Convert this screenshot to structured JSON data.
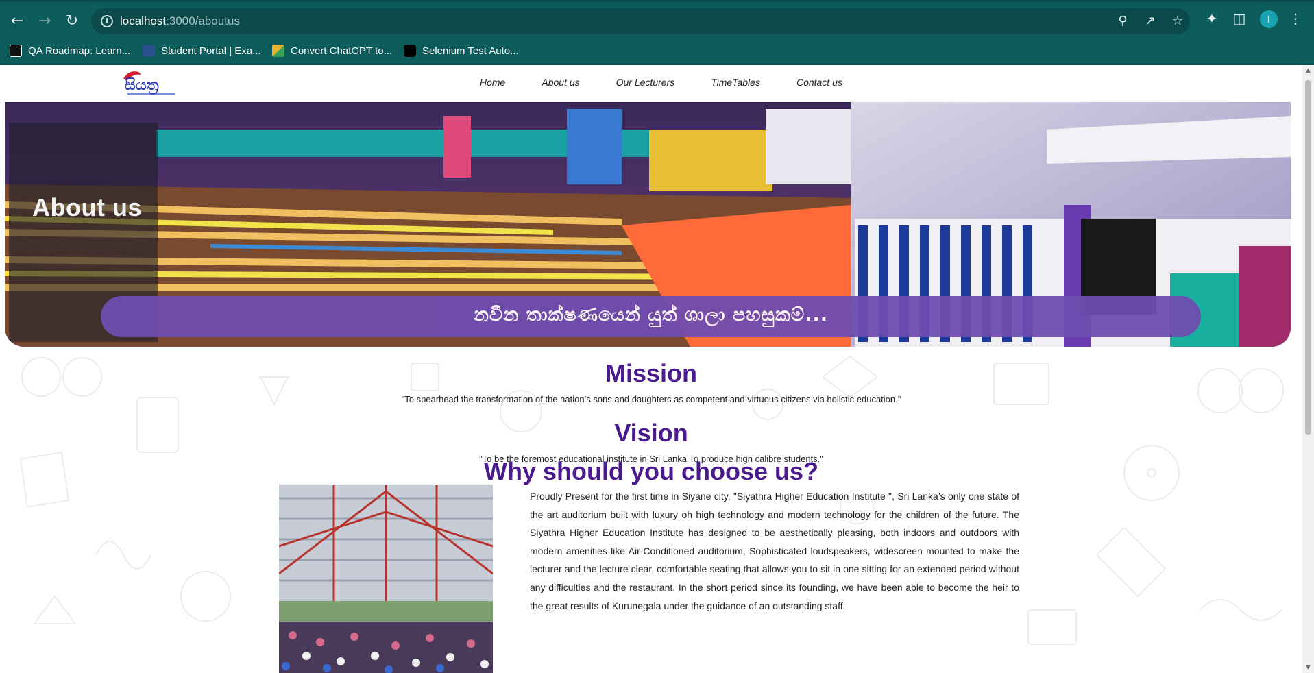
{
  "browser": {
    "url_host": "localhost",
    "url_path": ":3000/aboutus",
    "profile_initial": "I",
    "bookmarks": [
      {
        "label": "QA Roadmap: Learn..."
      },
      {
        "label": "Student Portal | Exa..."
      },
      {
        "label": "Convert ChatGPT to..."
      },
      {
        "label": "Selenium Test Auto..."
      }
    ],
    "colors": {
      "chrome": "#0d5c5c",
      "omnibox": "#0a4a4a"
    }
  },
  "site": {
    "nav": {
      "links": [
        {
          "label": "Home"
        },
        {
          "label": "About us"
        },
        {
          "label": "Our Lecturers"
        },
        {
          "label": "TimeTables"
        },
        {
          "label": "Contact us"
        }
      ]
    },
    "hero": {
      "title": "About us",
      "banner_text": "නවීන තාක්ෂණයෙන් යුත් ශාලා පහසුකම්..."
    },
    "mission": {
      "heading": "Mission",
      "text": "\"To spearhead the transformation of the nation’s sons and daughters as competent and virtuous citizens via holistic education.\""
    },
    "vision": {
      "heading": "Vision",
      "text": "\"To be the foremost educational institute in Sri Lanka To produce high calibre students.\""
    },
    "why": {
      "heading": "Why should you choose us?",
      "text": "Proudly Present for the first time in Siyane city, \"Siyathra Higher Education Institute \", Sri Lanka’s only one state of the art auditorium built with luxury oh high technology and modern technology for the children of the future. The Siyathra Higher Education Institute has designed to be aesthetically pleasing, both indoors and outdoors with modern amenities like Air-Conditioned auditorium, Sophisticated loudspeakers, widescreen mounted to make the lecturer and the lecture clear, comfortable seating that allows you to sit in one sitting for an extended period without any difficulties and the restaurant. In the short period since its founding, we have been able to become the heir to the great results of Kurunegala under the guidance of an outstanding staff."
    },
    "colors": {
      "heading": "#4a1a8e",
      "banner": "#6f4db0"
    }
  }
}
